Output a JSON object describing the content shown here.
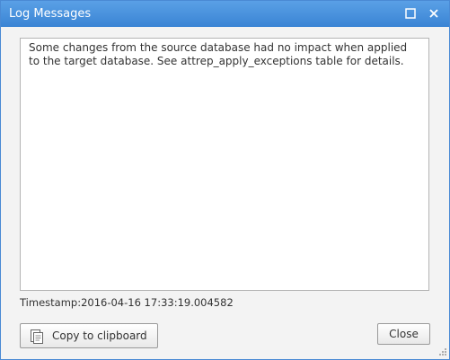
{
  "window": {
    "title": "Log Messages",
    "maximize_icon": "maximize-icon",
    "close_icon": "close-icon"
  },
  "message": {
    "text": "Some changes from the source database had no impact when applied to the target database. See attrep_apply_exceptions table for details."
  },
  "timestamp": {
    "text": "Timestamp:2016-04-16 17:33:19.004582"
  },
  "buttons": {
    "copy_label": "Copy to clipboard",
    "copy_icon": "clipboard-icon",
    "close_label": "Close"
  },
  "colors": {
    "titlebar": "#4a8ad4",
    "dialog_bg": "#f3f3f3"
  }
}
